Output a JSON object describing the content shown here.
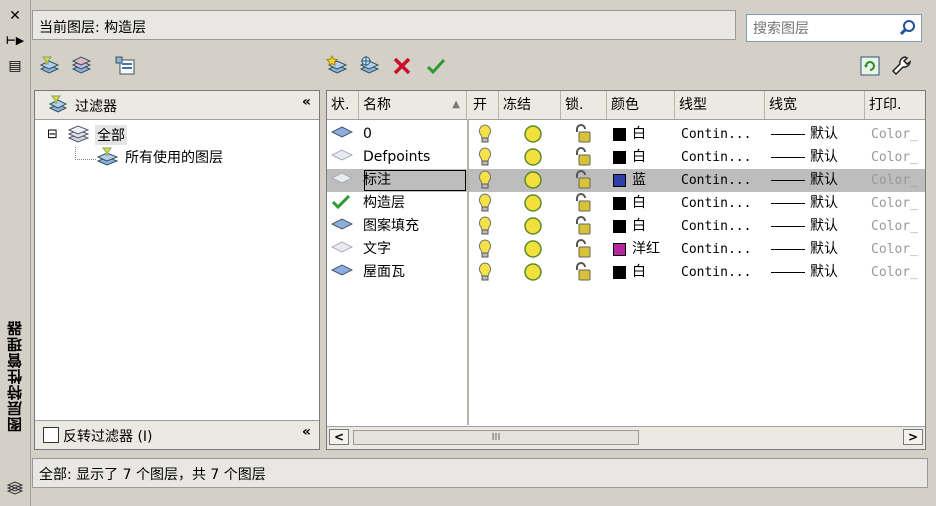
{
  "sidebar": {
    "title": "图层特性管理器",
    "close_glyph": "✕",
    "pin_glyph": "⊢▶",
    "props_glyph": "▤"
  },
  "header": {
    "current_layer_label": "当前图层: 构造层",
    "search": {
      "placeholder": "搜索图层"
    }
  },
  "filters": {
    "header": "过滤器",
    "collapse": "«",
    "tree": [
      {
        "label": "全部",
        "expander": "⊟"
      },
      {
        "label": "所有使用的图层"
      }
    ],
    "invert_label": "反转过滤器 (I)",
    "footer_collapse": "«"
  },
  "columns": [
    "状.",
    "名称",
    "开",
    "冻结",
    "锁.",
    "颜色",
    "线型",
    "线宽",
    "打印."
  ],
  "layers": [
    {
      "status": "layer",
      "name": "0",
      "color_name": "白",
      "color": "#000000",
      "linetype": "Contin...",
      "lineweight": "默认",
      "plot": "Color_"
    },
    {
      "status": "layer-faded",
      "name": "Defpoints",
      "color_name": "白",
      "color": "#000000",
      "linetype": "Contin...",
      "lineweight": "默认",
      "plot": "Color_"
    },
    {
      "status": "layer-faded",
      "name": "标注",
      "color_name": "蓝",
      "color": "#2b3fa8",
      "linetype": "Contin...",
      "lineweight": "默认",
      "plot": "Color_",
      "selected": true
    },
    {
      "status": "current",
      "name": "构造层",
      "color_name": "白",
      "color": "#000000",
      "linetype": "Contin...",
      "lineweight": "默认",
      "plot": "Color_"
    },
    {
      "status": "layer",
      "name": "图案填充",
      "color_name": "白",
      "color": "#000000",
      "linetype": "Contin...",
      "lineweight": "默认",
      "plot": "Color_"
    },
    {
      "status": "layer-faded",
      "name": "文字",
      "color_name": "洋红",
      "color": "#b3289d",
      "linetype": "Contin...",
      "lineweight": "默认",
      "plot": "Color_"
    },
    {
      "status": "layer",
      "name": "屋面瓦",
      "color_name": "白",
      "color": "#000000",
      "linetype": "Contin...",
      "lineweight": "默认",
      "plot": "Color_"
    }
  ],
  "scrollbar": {
    "thumb_grip": "III",
    "left": "<",
    "right": ">"
  },
  "status_bar": "全部: 显示了 7 个图层，共 7 个图层",
  "colors": {
    "bulb": "#f4e24a",
    "sun": "#f2e03c",
    "lock": "#d8c23a",
    "current_check": "#2c9a2c",
    "delete_x": "#c8102e"
  }
}
